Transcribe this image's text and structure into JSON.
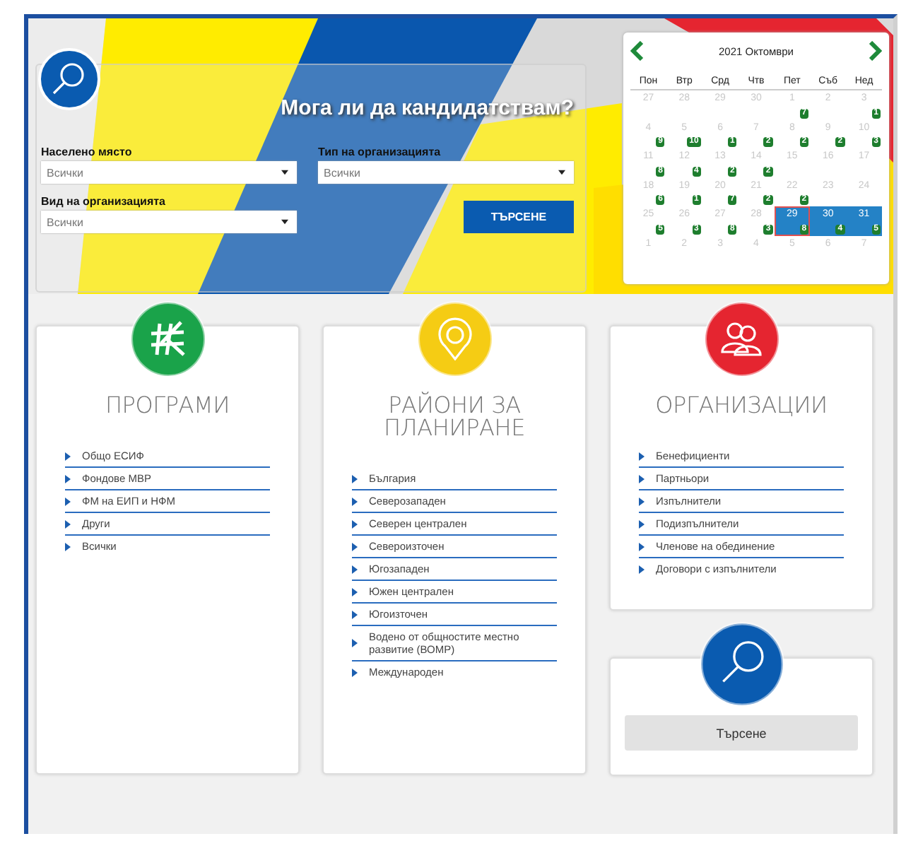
{
  "search_panel": {
    "title": "Мога ли да кандидатствам?",
    "fields": [
      {
        "label": "Населено място",
        "value": "Всички"
      },
      {
        "label": "Тип на организацията",
        "value": "Всички"
      },
      {
        "label": "Вид на организацията",
        "value": "Всички"
      }
    ],
    "button": "ТЪРСЕНЕ"
  },
  "calendar": {
    "title": "2021 Октомври",
    "weekdays": [
      "Пон",
      "Втр",
      "Срд",
      "Чтв",
      "Пет",
      "Съб",
      "Нед"
    ],
    "weeks": [
      [
        {
          "day": "27",
          "selected": false,
          "today": false
        },
        {
          "day": "28",
          "selected": false,
          "today": false
        },
        {
          "day": "29",
          "selected": false,
          "today": false
        },
        {
          "day": "30",
          "selected": false,
          "today": false
        },
        {
          "day": "1",
          "count": "7",
          "selected": false,
          "today": false
        },
        {
          "day": "2",
          "selected": false,
          "today": false
        },
        {
          "day": "3",
          "count": "1",
          "selected": false,
          "today": false
        }
      ],
      [
        {
          "day": "4",
          "count": "9",
          "selected": false,
          "today": false
        },
        {
          "day": "5",
          "count": "10",
          "selected": false,
          "today": false
        },
        {
          "day": "6",
          "count": "1",
          "selected": false,
          "today": false
        },
        {
          "day": "7",
          "count": "2",
          "selected": false,
          "today": false
        },
        {
          "day": "8",
          "count": "2",
          "selected": false,
          "today": false
        },
        {
          "day": "9",
          "count": "2",
          "selected": false,
          "today": false
        },
        {
          "day": "10",
          "count": "3",
          "selected": false,
          "today": false
        }
      ],
      [
        {
          "day": "11",
          "count": "8",
          "selected": false,
          "today": false
        },
        {
          "day": "12",
          "count": "4",
          "selected": false,
          "today": false
        },
        {
          "day": "13",
          "count": "2",
          "selected": false,
          "today": false
        },
        {
          "day": "14",
          "count": "2",
          "selected": false,
          "today": false
        },
        {
          "day": "15",
          "selected": false,
          "today": false
        },
        {
          "day": "16",
          "selected": false,
          "today": false
        },
        {
          "day": "17",
          "selected": false,
          "today": false
        }
      ],
      [
        {
          "day": "18",
          "count": "6",
          "selected": false,
          "today": false
        },
        {
          "day": "19",
          "count": "1",
          "selected": false,
          "today": false
        },
        {
          "day": "20",
          "count": "7",
          "selected": false,
          "today": false
        },
        {
          "day": "21",
          "count": "2",
          "selected": false,
          "today": false
        },
        {
          "day": "22",
          "count": "2",
          "selected": false,
          "today": false
        },
        {
          "day": "23",
          "selected": false,
          "today": false
        },
        {
          "day": "24",
          "selected": false,
          "today": false
        }
      ],
      [
        {
          "day": "25",
          "count": "5",
          "selected": false,
          "today": false
        },
        {
          "day": "26",
          "count": "3",
          "selected": false,
          "today": false
        },
        {
          "day": "27",
          "count": "8",
          "selected": false,
          "today": false
        },
        {
          "day": "28",
          "count": "3",
          "selected": false,
          "today": false
        },
        {
          "day": "29",
          "count": "8",
          "selected": true,
          "today": true
        },
        {
          "day": "30",
          "count": "4",
          "selected": true,
          "today": false
        },
        {
          "day": "31",
          "count": "5",
          "selected": true,
          "today": false
        }
      ],
      [
        {
          "day": "1",
          "selected": false,
          "today": false
        },
        {
          "day": "2",
          "selected": false,
          "today": false
        },
        {
          "day": "3",
          "selected": false,
          "today": false
        },
        {
          "day": "4",
          "selected": false,
          "today": false
        },
        {
          "day": "5",
          "selected": false,
          "today": false
        },
        {
          "day": "6",
          "selected": false,
          "today": false
        },
        {
          "day": "7",
          "selected": false,
          "today": false
        }
      ]
    ]
  },
  "cards": [
    {
      "kind": "programs",
      "title": "ПРОГРАМИ",
      "links": [
        "Общо ЕСИФ",
        "Фондове МВР",
        "ФМ на ЕИП и НФМ",
        "Други",
        "Всички"
      ]
    },
    {
      "kind": "regions",
      "title": "РАЙОНИ ЗА ПЛАНИРАНЕ",
      "links": [
        "България",
        "Северозападен",
        "Северен централен",
        "Североизточен",
        "Югозападен",
        "Южен централен",
        "Югоизточен",
        "Водено от общностите местно развитие (ВОМР)",
        "Международен"
      ]
    },
    {
      "kind": "organizations",
      "title": "ОРГАНИЗАЦИИ",
      "links": [
        "Бенефициенти",
        "Партньори",
        "Изпълнители",
        "Подизпълнители",
        "Членове на обединение",
        "Договори с изпълнители"
      ]
    }
  ],
  "search_card": {
    "button": "Търсене"
  }
}
